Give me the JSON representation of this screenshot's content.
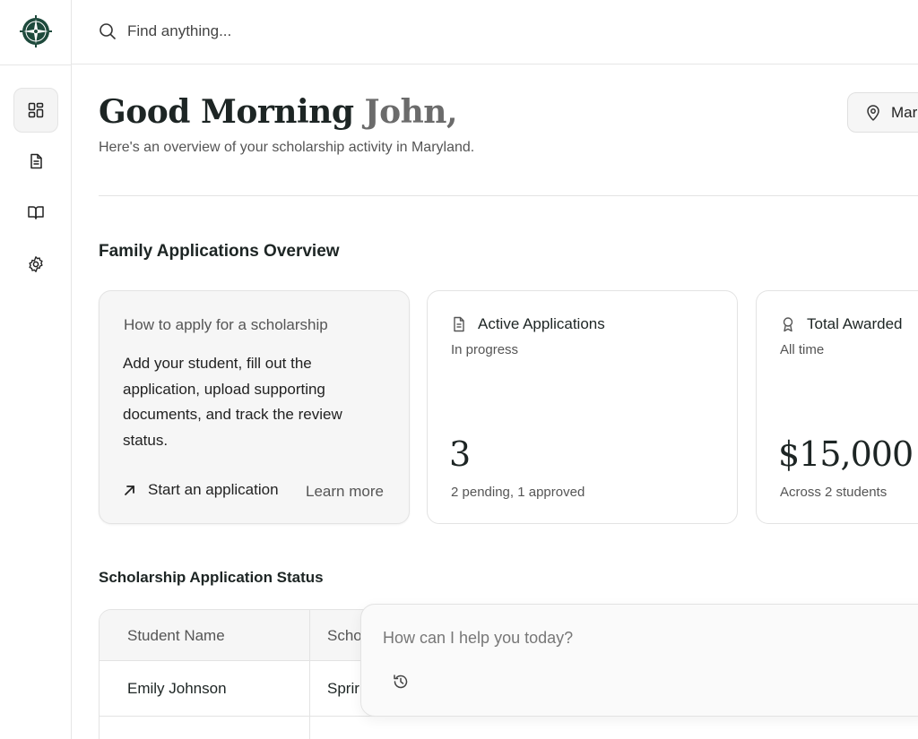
{
  "brand": {
    "logo_icon": "compass-icon",
    "accent_color": "#1e4a3c"
  },
  "sidebar": {
    "items": [
      {
        "name": "dashboard",
        "icon": "dashboard-grid-icon",
        "active": true
      },
      {
        "name": "applications",
        "icon": "document-icon",
        "active": false
      },
      {
        "name": "resources",
        "icon": "book-open-icon",
        "active": false
      },
      {
        "name": "settings",
        "icon": "gear-icon",
        "active": false
      }
    ]
  },
  "search": {
    "placeholder": "Find anything..."
  },
  "header": {
    "greeting": "Good Morning",
    "user_name": "John,",
    "subtitle": "Here's an overview of your scholarship activity in Maryland.",
    "location_label": "Mar"
  },
  "overview": {
    "title": "Family Applications Overview",
    "help_card": {
      "title": "How to apply for a scholarship",
      "body": "Add your student, fill out the application, upload supporting documents, and track the review status.",
      "start_label": "Start an application",
      "learn_label": "Learn more"
    },
    "active_card": {
      "title": "Active Applications",
      "subtitle": "In progress",
      "value": "3",
      "footer": "2 pending, 1 approved"
    },
    "awarded_card": {
      "title": "Total Awarded",
      "subtitle": "All time",
      "value": "$15,000",
      "footer": "Across 2 students"
    }
  },
  "status": {
    "title": "Scholarship Application Status",
    "headers": [
      "Student Name",
      "Scho"
    ],
    "rows": [
      [
        "Emily Johnson",
        "Sprir"
      ]
    ]
  },
  "chat": {
    "placeholder": "How can I help you today?",
    "history_icon": "history-icon"
  }
}
